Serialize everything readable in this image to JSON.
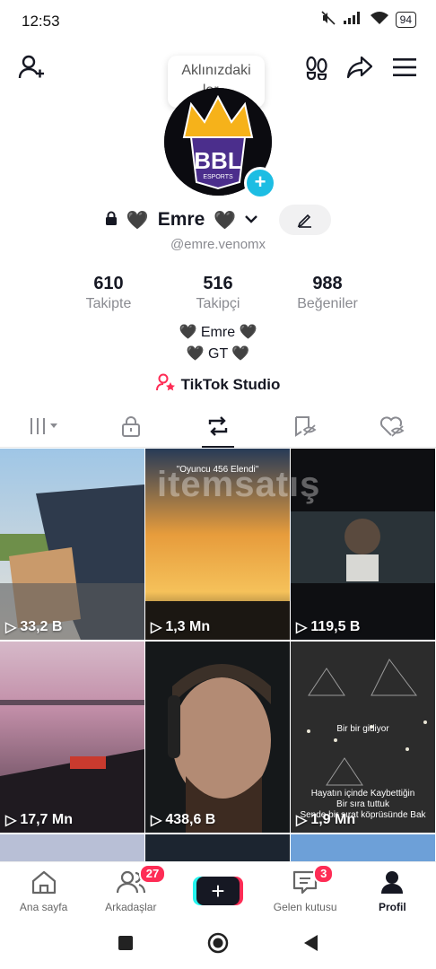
{
  "status": {
    "time": "12:53",
    "battery": "94"
  },
  "header": {
    "tooltip_line1": "Aklınızdaki",
    "tooltip_line2": "ler..."
  },
  "profile": {
    "name": "Emre",
    "handle": "@emre.venomx",
    "logo_text": "BBL",
    "logo_sub": "ESPORTS",
    "stats": [
      {
        "value": "610",
        "label": "Takipte"
      },
      {
        "value": "516",
        "label": "Takipçi"
      },
      {
        "value": "988",
        "label": "Beğeniler"
      }
    ],
    "bio_line1": "🖤 Emre 🖤",
    "bio_line2": "🖤 GT 🖤",
    "studio_label": "TikTok Studio"
  },
  "videos": [
    {
      "views": "33,2 B"
    },
    {
      "views": "1,3 Mn",
      "caption": "\"Oyuncu 456 Elendi\""
    },
    {
      "views": "119,5 B"
    },
    {
      "views": "17,7 Mn"
    },
    {
      "views": "438,6 B"
    },
    {
      "views": "1,9 Mn",
      "caption_top": "Bir bir gidiyor",
      "caption_bottom_1": "Hayatın içinde Kaybettiğin",
      "caption_bottom_2": "Bir sıra tuttuk",
      "caption_bottom_3": "Sende bir sırat köprüsünde  Bak"
    }
  ],
  "watermark": "itemsatış",
  "nav": {
    "items": [
      {
        "label": "Ana sayfa"
      },
      {
        "label": "Arkadaşlar",
        "badge": "27"
      },
      {
        "label": ""
      },
      {
        "label": "Gelen kutusu",
        "badge": "3"
      },
      {
        "label": "Profil"
      }
    ]
  },
  "colors": {
    "accent": "#fe2c55",
    "cyan": "#25f4ee",
    "blue_badge": "#1dbde3"
  }
}
